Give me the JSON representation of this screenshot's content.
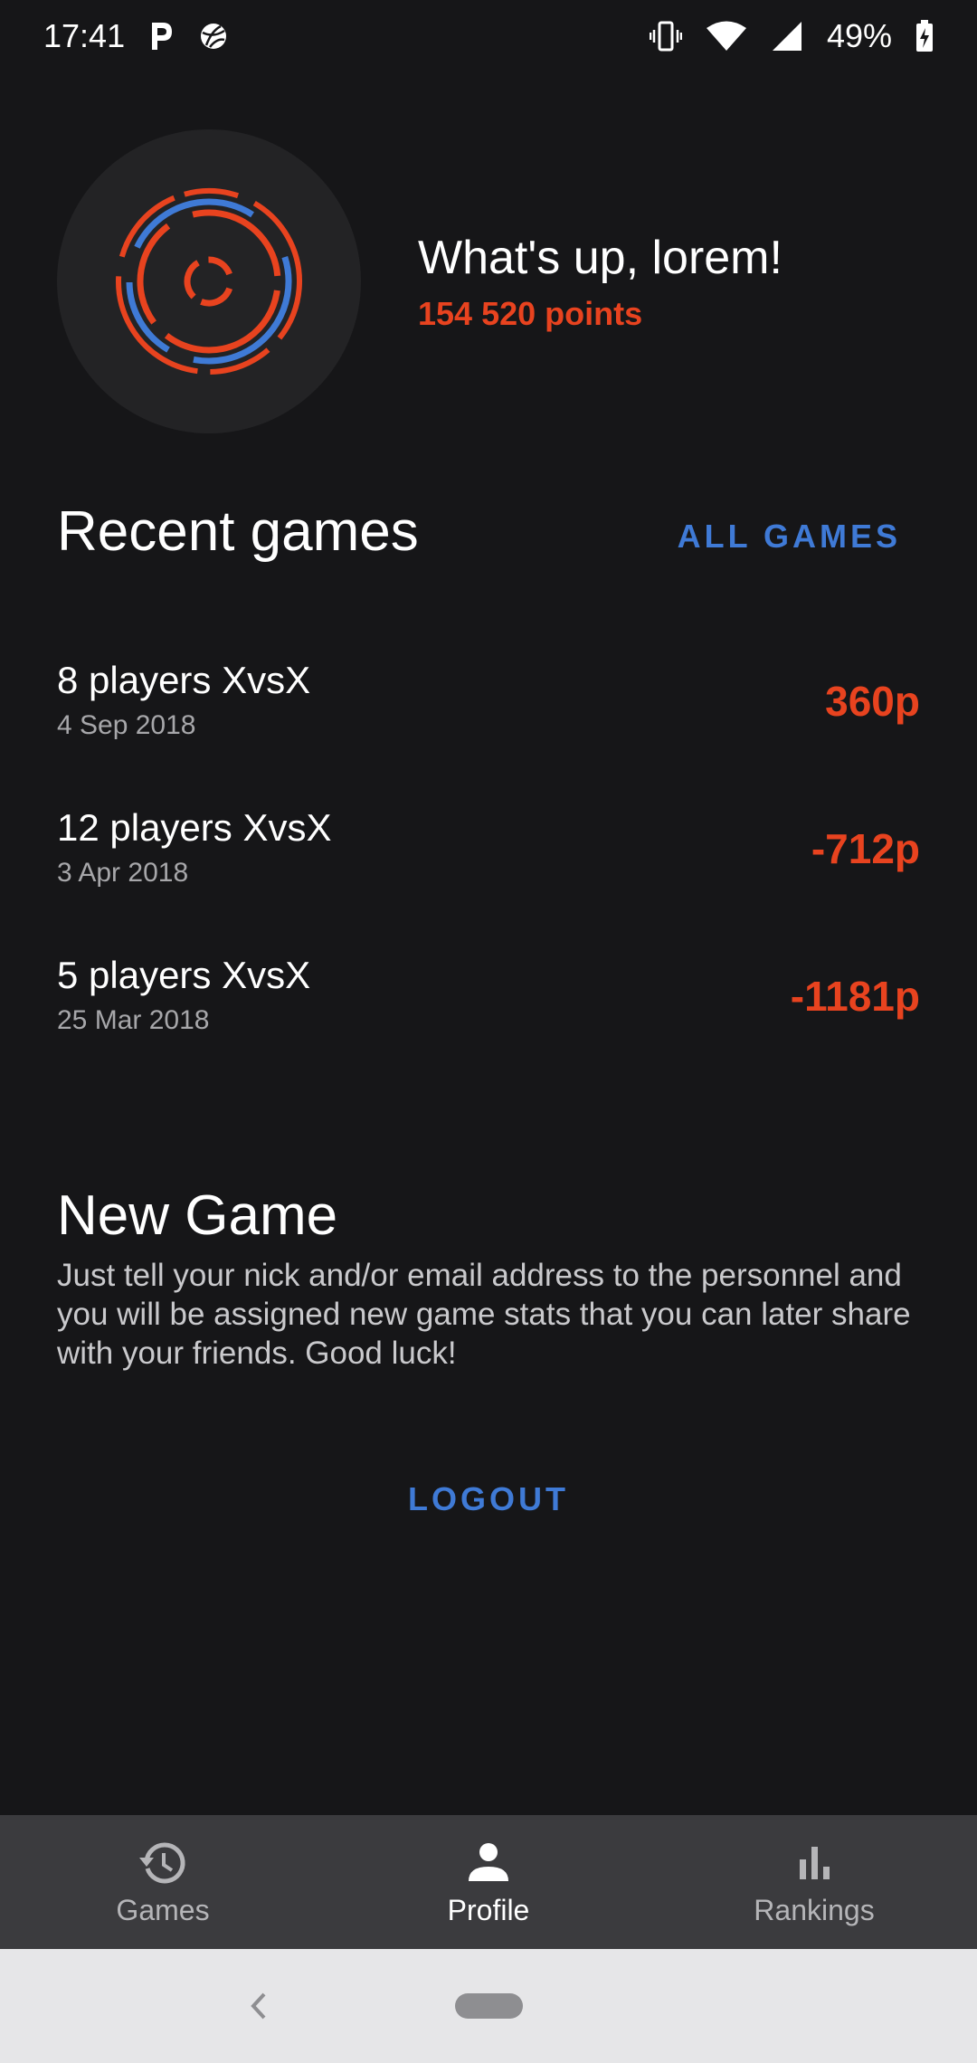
{
  "status_bar": {
    "time": "17:41",
    "battery": "49%",
    "icons": [
      "p-app-icon",
      "basketball-icon",
      "vibrate-icon",
      "wifi-icon",
      "signal-icon",
      "battery-charging-icon"
    ]
  },
  "profile": {
    "greeting": "What's up, lorem!",
    "points": "154 520 points",
    "avatar_icon": "concentric-rings-logo"
  },
  "recent_games": {
    "title": "Recent games",
    "all_games_label": "ALL GAMES",
    "items": [
      {
        "title": "8 players XvsX",
        "date": "4 Sep 2018",
        "score": "360p"
      },
      {
        "title": "12 players XvsX",
        "date": "3 Apr 2018",
        "score": "-712p"
      },
      {
        "title": "5 players XvsX",
        "date": "25 Mar 2018",
        "score": "-1181p"
      }
    ]
  },
  "new_game": {
    "title": "New Game",
    "description": "Just tell your nick and/or email address to the personnel and you will be assigned new game stats that you can later share with your friends. Good luck!"
  },
  "logout_label": "LOGOUT",
  "bottom_nav": {
    "items": [
      {
        "label": "Games",
        "icon": "history-icon"
      },
      {
        "label": "Profile",
        "icon": "person-icon"
      },
      {
        "label": "Rankings",
        "icon": "bar-chart-icon"
      }
    ],
    "active": "Profile"
  },
  "colors": {
    "background": "#161618",
    "accent_orange": "#e8431f",
    "accent_blue": "#3f7ad6",
    "nav_background": "#3b3b3e"
  }
}
